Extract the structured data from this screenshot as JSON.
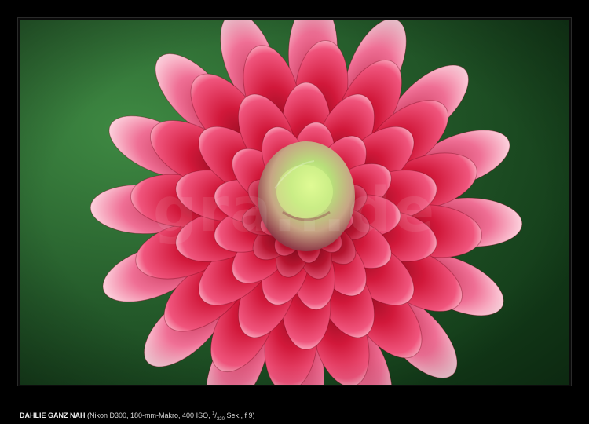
{
  "photo": {
    "subject": "dahlia-flower",
    "watermark": "gra...de",
    "colors": {
      "background_green": "#2f6a35",
      "petal_red": "#d41a3a",
      "petal_pink": "#f07aa0",
      "center_green": "#b8e07a"
    }
  },
  "caption": {
    "title": "DAHLIE GANZ NAH",
    "details_prefix": "(Nikon D300, 180-mm-Makro, 400 ISO, ",
    "shutter_numerator": "1",
    "shutter_slash": "/",
    "shutter_denominator": "320",
    "details_suffix": " Sek., f 9)"
  }
}
